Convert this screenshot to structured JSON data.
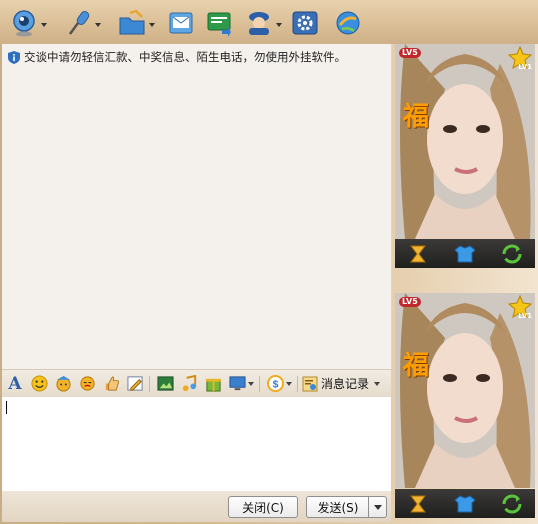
{
  "notice": {
    "text": "交谈中请勿轻信汇款、中奖信息、陌生电话，勿使用外挂软件。"
  },
  "toolbar": {
    "buttons": [
      {
        "icon": "webcam-icon",
        "has_dropdown": true
      },
      {
        "icon": "microphone-icon",
        "has_dropdown": true
      },
      {
        "icon": "folder-transfer-icon",
        "has_dropdown": true
      },
      {
        "icon": "email-icon",
        "has_dropdown": false
      },
      {
        "icon": "sms-icon",
        "has_dropdown": false
      },
      {
        "icon": "contact-card-icon",
        "has_dropdown": true
      },
      {
        "icon": "app-settings-icon",
        "has_dropdown": false
      },
      {
        "icon": "share-globe-icon",
        "has_dropdown": false
      }
    ]
  },
  "format_bar": {
    "history_label": "消息记录"
  },
  "bottom_bar": {
    "close_label": "关闭(C)",
    "send_label": "发送(S)"
  },
  "video_panels": [
    {
      "level_badge": "LV5",
      "star_level": "LV1",
      "badge_char": "福"
    },
    {
      "level_badge": "LV5",
      "star_level": "LV1",
      "badge_char": "福"
    }
  ],
  "colors": {
    "accent_border": "#c9ad85",
    "chat_bg": "#f4f1ec",
    "controls_bg": "#2a2a28"
  }
}
